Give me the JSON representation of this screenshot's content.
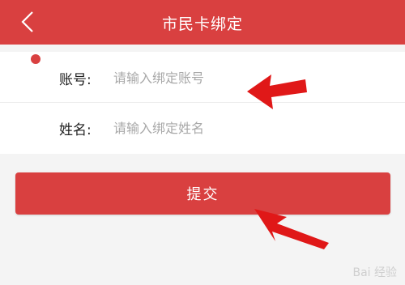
{
  "header": {
    "title": "市民卡绑定",
    "back_icon": "chevron-left-icon",
    "bg_color": "#d94040"
  },
  "form": {
    "account": {
      "label": "账号:",
      "placeholder": "请输入绑定账号"
    },
    "name": {
      "label": "姓名:",
      "placeholder": "请输入绑定姓名"
    }
  },
  "submit_label": "提交",
  "annotations": {
    "arrow_color": "#e01818",
    "arrow_icon": "red-arrow-annotation-icon"
  },
  "watermark": "Bai 经验"
}
